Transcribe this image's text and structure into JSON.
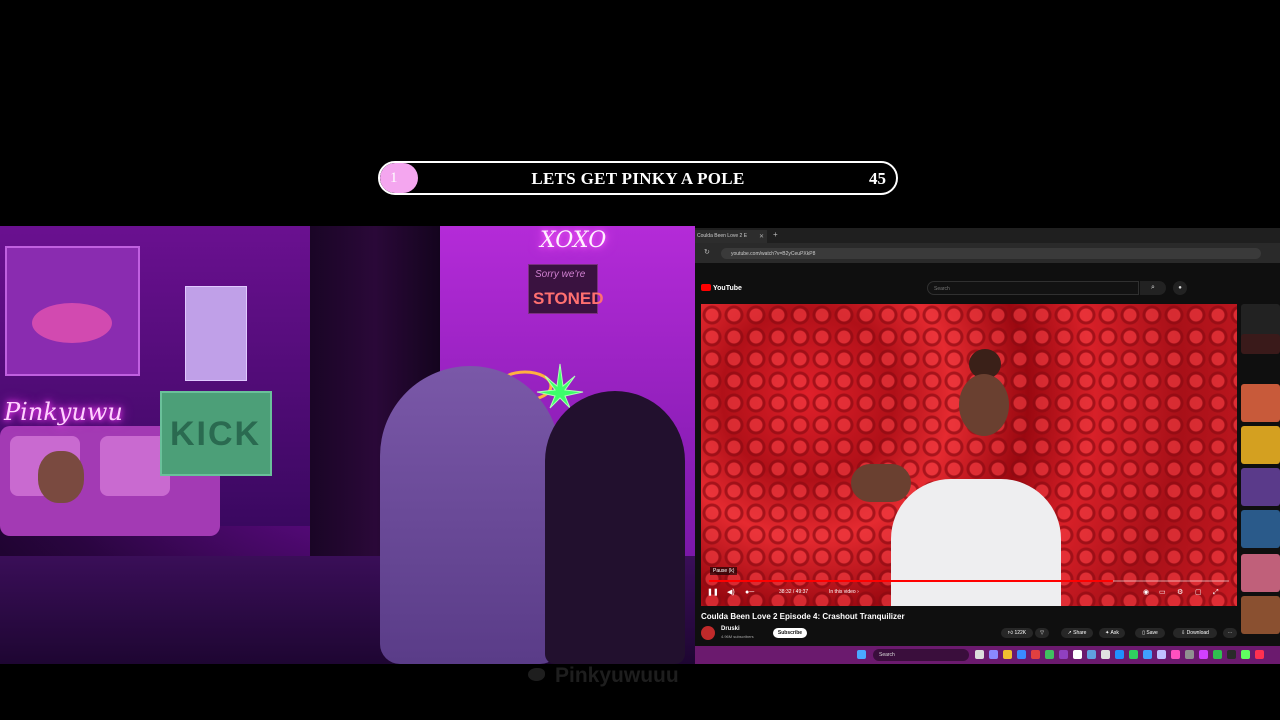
{
  "goal": {
    "current": "1",
    "title": "LETS GET PINKY A POLE",
    "target": "45",
    "progress_fraction": 0.0222,
    "fill_color": "#f4a6ef"
  },
  "webcam": {
    "neon_left": "Pinkyuwu",
    "kick_sign": "KICK",
    "neon_xoxo": "XOXO",
    "sign_top": "Sorry we're",
    "sign_main": "STONED"
  },
  "browser": {
    "tab_title": "Coulda Been Love 2 E",
    "url": "youtube.com/watch?v=B2yCeuPXkP8"
  },
  "youtube": {
    "logo": "YouTube",
    "search_placeholder": "Search",
    "pause_tooltip": "Pause (k)",
    "time": "38:32 / 49:37",
    "in_this_video": "In this video ›",
    "progress_fraction": 0.776,
    "video_title": "Coulda Been Love 2 Episode 4: Crashout Tranquilizer",
    "channel": "Druski",
    "subscribers": "4.96M subscribers",
    "subscribe": "Subscribe",
    "likes": "122K",
    "share": "Share",
    "ask": "Ask",
    "save": "Save",
    "download": "Download"
  },
  "taskbar": {
    "search": "Search"
  },
  "watermark": {
    "handle": "Pinkyuwuuu"
  }
}
